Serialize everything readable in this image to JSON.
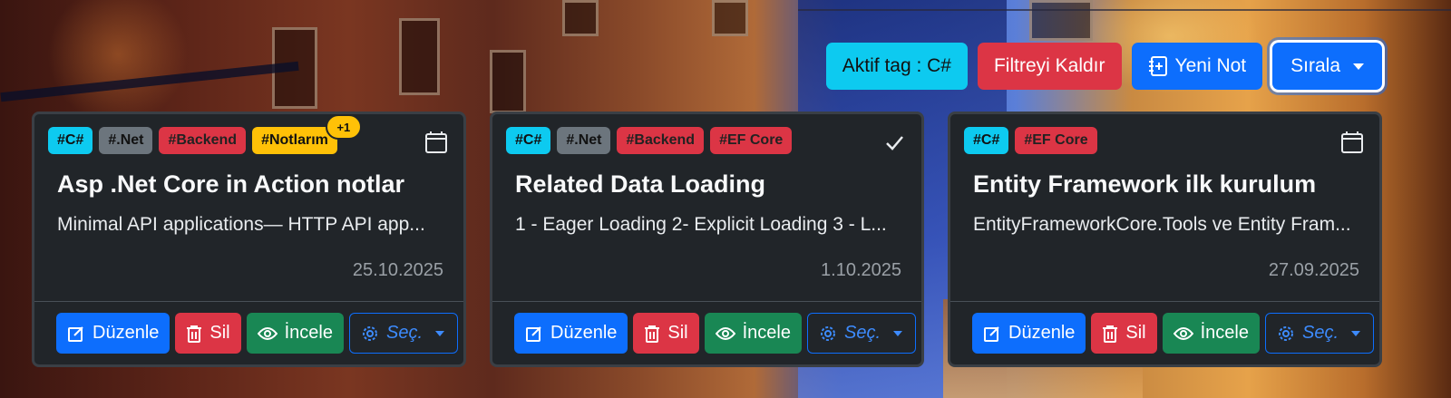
{
  "toolbar": {
    "active_tag_label": "Aktif tag : C#",
    "clear_filter_label": "Filtreyi Kaldır",
    "new_note_label": "Yeni Not",
    "sort_label": "Sırala"
  },
  "cards": [
    {
      "tags": [
        "#C#",
        "#.Net",
        "#Backend",
        "#Notlarım"
      ],
      "extra_tag_count": "+1",
      "corner_icon": "calendar-icon",
      "title": "Asp .Net Core in Action notlar",
      "text": "Minimal API applications— HTTP API app...",
      "date": "25.10.2025"
    },
    {
      "tags": [
        "#C#",
        "#.Net",
        "#Backend",
        "#EF Core"
      ],
      "corner_icon": "check-icon",
      "title": "Related Data Loading",
      "text": "1 - Eager Loading 2- Explicit Loading 3 - L...",
      "date": "1.10.2025"
    },
    {
      "tags": [
        "#C#",
        "#EF Core"
      ],
      "corner_icon": "calendar-icon",
      "title": "Entity Framework ilk kurulum",
      "text": "EntityFrameworkCore.Tools ve Entity Fram...",
      "date": "27.09.2025"
    }
  ],
  "card_actions": {
    "edit_label": "Düzenle",
    "delete_label": "Sil",
    "view_label": "İncele",
    "select_label": "Seç."
  },
  "colors": {
    "primary": "#0d6efd",
    "danger": "#dc3545",
    "success": "#198754",
    "info": "#0dcaf0",
    "warning": "#ffc107",
    "secondary": "#6c757d",
    "card_bg": "#212529"
  }
}
